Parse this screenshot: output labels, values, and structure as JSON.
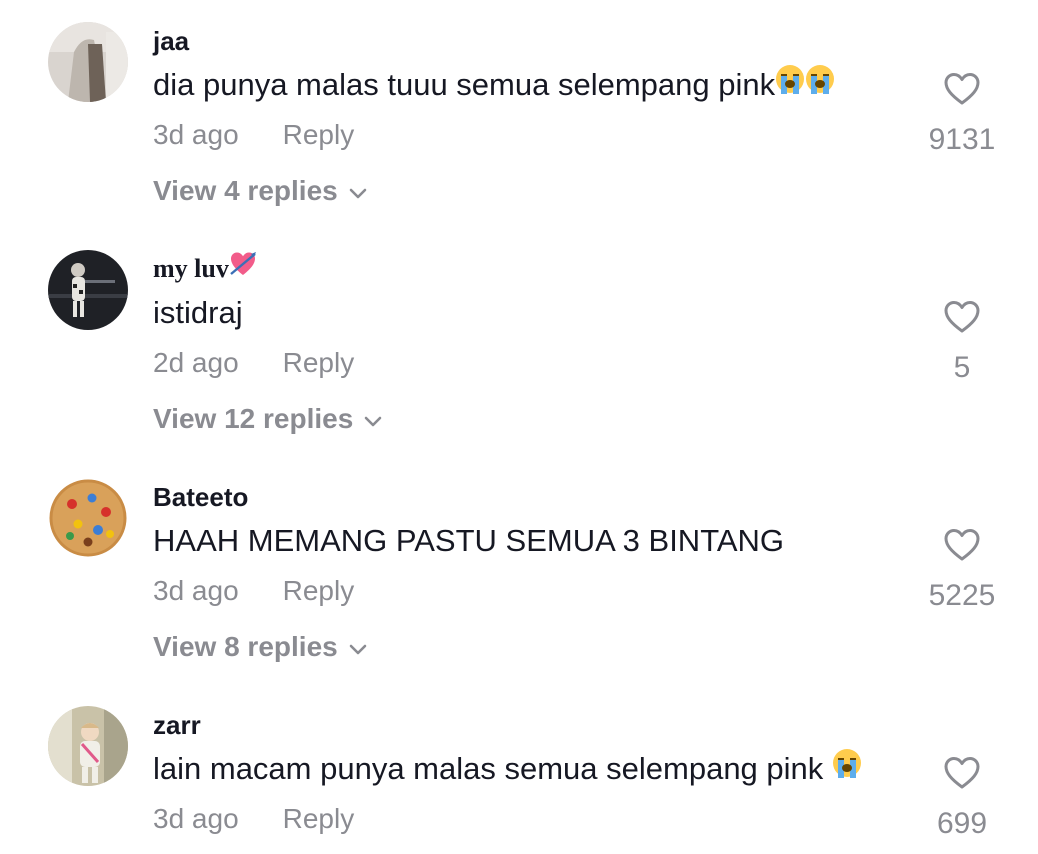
{
  "colors": {
    "primary_text": "#161823",
    "secondary_text": "#8a8b91",
    "background": "#ffffff",
    "heart_outline": "#8a8b91"
  },
  "comments": [
    {
      "username": "jaa",
      "text": "dia punya malas tuuu semua selempang pink",
      "emoji": [
        "loudly-crying-face",
        "loudly-crying-face"
      ],
      "time": "3d ago",
      "reply_label": "Reply",
      "likes": "9131",
      "view_replies": "View 4 replies",
      "avatar_icon": "avatar-person-grey"
    },
    {
      "username": "my luv",
      "username_emoji": "heart-with-arrow",
      "text": "istidraj",
      "time": "2d ago",
      "reply_label": "Reply",
      "likes": "5",
      "view_replies": "View 12 replies",
      "avatar_icon": "avatar-figure-dark"
    },
    {
      "username": "Bateeto",
      "text": "HAAH MEMANG PASTU SEMUA 3 BINTANG",
      "time": "3d ago",
      "reply_label": "Reply",
      "likes": "5225",
      "view_replies": "View 8 replies",
      "avatar_icon": "avatar-cookie"
    },
    {
      "username": "zarr",
      "text": "lain macam punya malas semua selempang pink",
      "emoji": [
        "loudly-crying-face"
      ],
      "time": "3d ago",
      "reply_label": "Reply",
      "likes": "699",
      "avatar_icon": "avatar-child-photo"
    }
  ]
}
